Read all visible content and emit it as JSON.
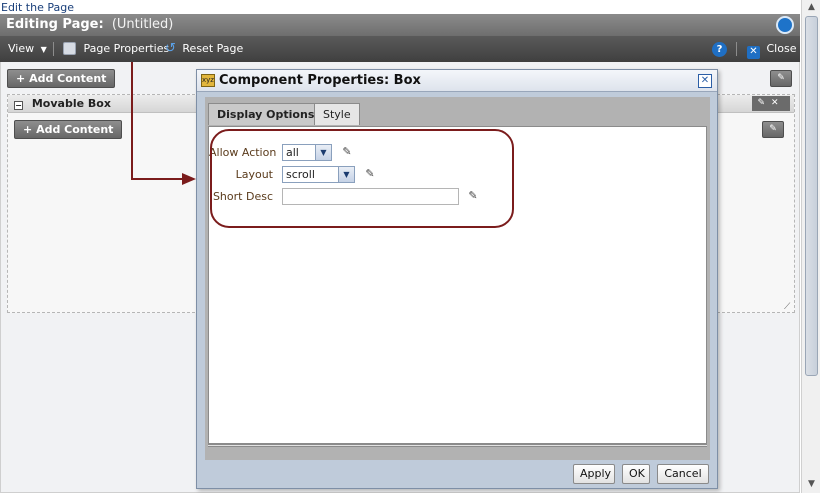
{
  "top_link": "Edit the Page",
  "titlebar": {
    "title": "Editing Page:",
    "subtitle": "(Untitled)"
  },
  "toolbar": {
    "view_label": "View",
    "page_properties_label": "Page Properties",
    "reset_page_label": "Reset Page",
    "help_glyph": "?",
    "close_label": "Close"
  },
  "page": {
    "add_content_label": "Add Content",
    "movable_box_title": "Movable Box",
    "inner_add_content_label": "Add Content"
  },
  "dialog": {
    "title": "Component Properties: Box",
    "tabs": [
      {
        "label": "Display Options",
        "active": true
      },
      {
        "label": "Style",
        "active": false
      }
    ],
    "fields": {
      "allow_action": {
        "label": "Allow Action",
        "value": "all"
      },
      "layout": {
        "label": "Layout",
        "value": "scroll"
      },
      "short_desc": {
        "label": "Short Desc",
        "value": ""
      }
    },
    "buttons": {
      "apply": "Apply",
      "ok": "OK",
      "cancel": "Cancel"
    }
  },
  "colors": {
    "annotation": "#7b1c1c",
    "toolbar_bg": "#4a4a4a",
    "dialog_bg": "#bfcbda",
    "label_text": "#5a3b1c"
  }
}
